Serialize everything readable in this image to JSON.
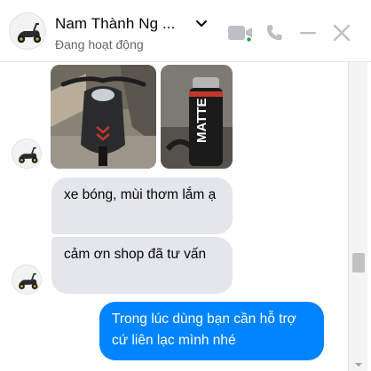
{
  "header": {
    "contact_name": "Nam Thành Ng ...",
    "status": "Đang hoạt động",
    "icons": [
      "video-call-icon",
      "phone-icon",
      "minimize-icon",
      "close-icon"
    ]
  },
  "messages": [
    {
      "from": "contact",
      "type": "photos",
      "photos": [
        "scooter-photo",
        "matte-spray-can-photo"
      ],
      "spray_label": "MATTE"
    },
    {
      "from": "contact",
      "type": "text",
      "text": "xe bóng, mùi thơm lắm ạ"
    },
    {
      "from": "contact",
      "type": "text",
      "text": "cảm ơn shop đã tư vấn"
    },
    {
      "from": "me",
      "type": "text",
      "text": "Trong lúc dùng bạn cần hỗ trợ cứ liên lạc mình nhé"
    }
  ],
  "colors": {
    "outgoing_bubble": "#0084ff",
    "incoming_bubble": "#e4e6eb",
    "header_icons": "#bcc0c4",
    "active_dot": "#31a24c"
  }
}
